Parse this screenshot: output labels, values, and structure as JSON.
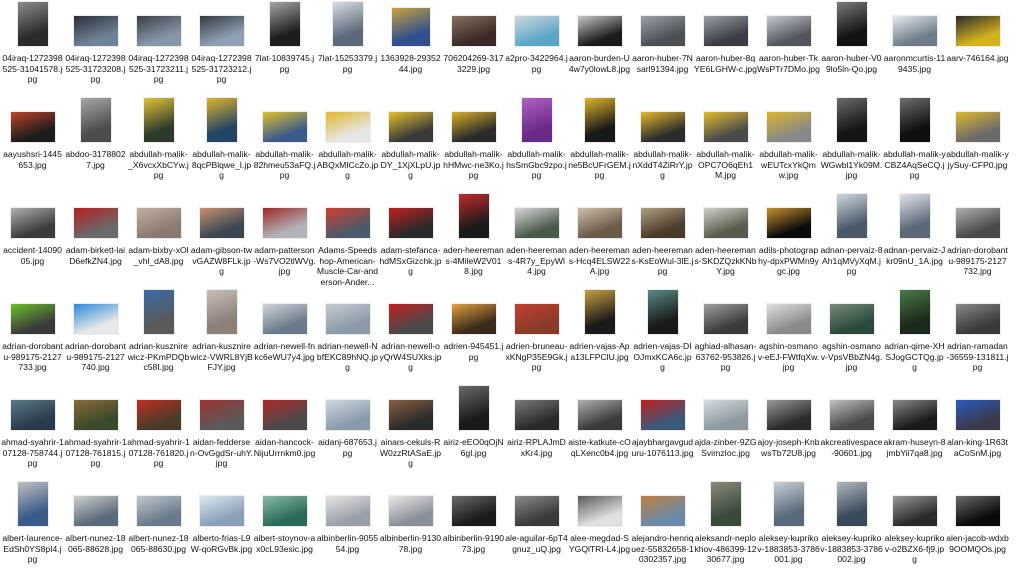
{
  "files": [
    {
      "name": "04iraq-1272398525-31041578.jpg",
      "shape": "portrait",
      "c1": "#2b2b2b",
      "c2": "#8c8c8c"
    },
    {
      "name": "04iraq-1272398525-31723208.jpg",
      "shape": "landscape",
      "c1": "#6f8296",
      "c2": "#2a3038"
    },
    {
      "name": "04iraq-1272398525-31723211.jpg",
      "shape": "landscape",
      "c1": "#8797a8",
      "c2": "#3a3f46"
    },
    {
      "name": "04iraq-1272398525-31723212.jpg",
      "shape": "landscape",
      "c1": "#8fa0b2",
      "c2": "#353a42"
    },
    {
      "name": "7lat-10839745.jpg",
      "shape": "portrait",
      "c1": "#1d1d1d",
      "c2": "#a6a6a6"
    },
    {
      "name": "7lat-15253379.jpg",
      "shape": "portrait",
      "c1": "#5b6a7a",
      "c2": "#d9dde2"
    },
    {
      "name": "1363928-2935244.jpg",
      "shape": "square",
      "c1": "#2f4f8f",
      "c2": "#c9a33a"
    },
    {
      "name": "706204269-3173229.jpg",
      "shape": "landscape",
      "c1": "#3b2a24",
      "c2": "#8a7060"
    },
    {
      "name": "a2pro-3422964.jpg",
      "shape": "landscape",
      "c1": "#5aa6c6",
      "c2": "#d1d8de"
    },
    {
      "name": "aaron-burden-U4w7y0lowL8.jpg",
      "shape": "landscape",
      "c1": "#1b1b1b",
      "c2": "#c8c8c8"
    },
    {
      "name": "aaron-huber-7Nsarl91394.jpg",
      "shape": "landscape",
      "c1": "#4a4f54",
      "c2": "#9aa1a8"
    },
    {
      "name": "aaron-huber-8qYE6LGHW-c.jpg",
      "shape": "landscape",
      "c1": "#3a3e44",
      "c2": "#9a9fa6"
    },
    {
      "name": "aaron-huber-TkWsPTr7DMo.jpg",
      "shape": "landscape",
      "c1": "#50565c",
      "c2": "#c6cbd0"
    },
    {
      "name": "aaron-huber-V09lo5ln-Qo.jpg",
      "shape": "portrait",
      "c1": "#121212",
      "c2": "#7a7a7a"
    },
    {
      "name": "aaronmcurtis-119435.jpg",
      "shape": "landscape",
      "c1": "#6d7c88",
      "c2": "#e8ecef"
    },
    {
      "name": "aarv-746164.jpg",
      "shape": "landscape",
      "c1": "#d4b21e",
      "c2": "#2a2a2a"
    },
    {
      "name": "aayushsri-1445653.jpg",
      "shape": "landscape",
      "c1": "#1c1c1c",
      "c2": "#c0422a"
    },
    {
      "name": "abdoo-31788027.jpg",
      "shape": "portrait",
      "c1": "#4c4c4c",
      "c2": "#a8a8a8"
    },
    {
      "name": "abdullah-malik-_X6vcxXbCYw.jpg",
      "shape": "portrait",
      "c1": "#2c3b2c",
      "c2": "#e2c23a"
    },
    {
      "name": "abdullah-malik-8qcPBlqwe_I.jpg",
      "shape": "portrait",
      "c1": "#224466",
      "c2": "#e0b42a"
    },
    {
      "name": "abdullah-malik-82hmeu53aFQ.jpg",
      "shape": "landscape",
      "c1": "#3a5a8a",
      "c2": "#e0c030"
    },
    {
      "name": "abdullah-malik-ABQxMICcZo.jpg",
      "shape": "landscape",
      "c1": "#e6e6e6",
      "c2": "#e0b82a"
    },
    {
      "name": "abdullah-malik-DY_1XjXLpU.jpg",
      "shape": "landscape",
      "c1": "#3a3a3a",
      "c2": "#e4c02c"
    },
    {
      "name": "abdullah-malik-hHMwc-ne3Ko.jpg",
      "shape": "landscape",
      "c1": "#2a2a2a",
      "c2": "#d8b02a"
    },
    {
      "name": "abdullah-malik-hsSmGbc9zpo.jpg",
      "shape": "portrait",
      "c1": "#6a2a8a",
      "c2": "#b060c0"
    },
    {
      "name": "abdullah-malik-ne5BcUFrGEM.jpg",
      "shape": "portrait",
      "c1": "#181818",
      "c2": "#dfb42a"
    },
    {
      "name": "abdullah-malik-nXddT4ZiRrY.jpg",
      "shape": "landscape",
      "c1": "#2c2c2c",
      "c2": "#e2b82c"
    },
    {
      "name": "abdullah-malik-OPC7O6qEh1M.jpg",
      "shape": "landscape",
      "c1": "#4a4a4a",
      "c2": "#e2bc2c"
    },
    {
      "name": "abdullah-malik-wEUTcxYkQmw.jpg",
      "shape": "landscape",
      "c1": "#888888",
      "c2": "#dcb62a"
    },
    {
      "name": "abdullah-malik-WGwbl1Yk09M.jpg",
      "shape": "portrait",
      "c1": "#141414",
      "c2": "#6a6a6a"
    },
    {
      "name": "abdullah-malik-yCBZ4AqSeCQ.jpg",
      "shape": "portrait",
      "c1": "#0e0e0e",
      "c2": "#6e6e6e"
    },
    {
      "name": "abdullah-malik-yjySuy-CFP0.jpg",
      "shape": "landscape",
      "c1": "#6a6a6a",
      "c2": "#e0b82c"
    },
    {
      "name": "accident-1409005.jpg",
      "shape": "landscape",
      "c1": "#3c3c3c",
      "c2": "#b0b0b0"
    },
    {
      "name": "adam-birkett-laiD6efkZN4.jpg",
      "shape": "landscape",
      "c1": "#6a6a6a",
      "c2": "#b42020"
    },
    {
      "name": "adam-bixby-xOl_vhl_dA8.jpg",
      "shape": "landscape",
      "c1": "#8a7a70",
      "c2": "#c0b0a4"
    },
    {
      "name": "adam-gibson-twvGAZW8FLk.jpg",
      "shape": "landscape",
      "c1": "#3a4652",
      "c2": "#c89070"
    },
    {
      "name": "adam-patterson-Ws7VO2tlWVg.jpg",
      "shape": "landscape",
      "c1": "#b0b4b8",
      "c2": "#a02828"
    },
    {
      "name": "Adams-Speedshop-American-Muscle-Car-anderson-Ander...",
      "shape": "landscape",
      "c1": "#4a5a6a",
      "c2": "#d04030"
    },
    {
      "name": "adam-stefanca-hdMSxGizchk.jpg",
      "shape": "landscape",
      "c1": "#2a2a2a",
      "c2": "#c02020"
    },
    {
      "name": "aden-heeremans-4MileW2V018.jpg",
      "shape": "portrait",
      "c1": "#1a1a1a",
      "c2": "#c02a2a"
    },
    {
      "name": "aden-heeremans-4R7y_EpyWl4.jpg",
      "shape": "landscape",
      "c1": "#4a5a4a",
      "c2": "#d8d8d8"
    },
    {
      "name": "aden-heeremans-Hcq4ELSW22A.jpg",
      "shape": "landscape",
      "c1": "#6a5a4a",
      "c2": "#cfc0a8"
    },
    {
      "name": "aden-heeremans-KsEoWul-3lE.jpg",
      "shape": "landscape",
      "c1": "#4a3a2a",
      "c2": "#b0a080"
    },
    {
      "name": "aden-heeremans-SKDZQzkKNbY.jpg",
      "shape": "landscape",
      "c1": "#5a5a4a",
      "c2": "#d0d0c8"
    },
    {
      "name": "adils-photography-dpxPWMn9ygc.jpg",
      "shape": "landscape",
      "c1": "#0a0a0a",
      "c2": "#c89030"
    },
    {
      "name": "adnan-pervaiz-8Ah1qMVyXqM.jpg",
      "shape": "portrait",
      "c1": "#4a5868",
      "c2": "#d0d8e0"
    },
    {
      "name": "adnan-pervaiz-Jkr09nU_1A.jpg",
      "shape": "portrait",
      "c1": "#5a6878",
      "c2": "#e0e4e8"
    },
    {
      "name": "adrian-dorobantu-989175-2127732.jpg",
      "shape": "landscape",
      "c1": "#4a4a4a",
      "c2": "#b0b0b0"
    },
    {
      "name": "adrian-dorobantu-989175-2127733.jpg",
      "shape": "landscape",
      "c1": "#3a3a3a",
      "c2": "#6ac02a"
    },
    {
      "name": "adrian-dorobantu-989175-2127740.jpg",
      "shape": "landscape",
      "c1": "#e8e8e8",
      "c2": "#2a8ad8"
    },
    {
      "name": "adrian-kusznirewicz-PKmPDQbc58I.jpg",
      "shape": "portrait",
      "c1": "#5a5a5a",
      "c2": "#3a6aa8"
    },
    {
      "name": "adrian-kusznirewicz-VWRL8YjBFJY.jpg",
      "shape": "portrait",
      "c1": "#8a8078",
      "c2": "#c8c0b8"
    },
    {
      "name": "adrian-newell-fnkc6eWU7y4.jpg",
      "shape": "landscape",
      "c1": "#6a7a8a",
      "c2": "#d0d4d8"
    },
    {
      "name": "adrian-newell-NbfEKC89hNQ.jpg",
      "shape": "landscape",
      "c1": "#8a9aa8",
      "c2": "#c8ccd0"
    },
    {
      "name": "adrian-newell-oyQrW4SUXks.jpg",
      "shape": "landscape",
      "c1": "#4a4a4a",
      "c2": "#c02020"
    },
    {
      "name": "adrien-945451.jpg",
      "shape": "landscape",
      "c1": "#3a2a1a",
      "c2": "#e0a040"
    },
    {
      "name": "adrien-bruneau-xKNgP35E9Gk.jpg",
      "shape": "landscape",
      "c1": "#8a3a2a",
      "c2": "#c04030"
    },
    {
      "name": "adrien-vajas-Apa13LFPClU.jpg",
      "shape": "portrait",
      "c1": "#1a1a1a",
      "c2": "#c8a040"
    },
    {
      "name": "adrien-vajas-DIOJmxKCA6c.jpg",
      "shape": "portrait",
      "c1": "#1a1a1a",
      "c2": "#5a8a8a"
    },
    {
      "name": "aghiad-alhasan-63762-953826.jpg",
      "shape": "landscape",
      "c1": "#3a3a3a",
      "c2": "#a0a0a0"
    },
    {
      "name": "agshin-osmanov-eEJ-FWtfqXw.jpg",
      "shape": "landscape",
      "c1": "#8a8a8a",
      "c2": "#e0e0e0"
    },
    {
      "name": "agshin-osmanov-VpsVBbZN4g.jpg",
      "shape": "landscape",
      "c1": "#2a4a3a",
      "c2": "#7a8a7a"
    },
    {
      "name": "adrian-qime-XHSJogGCTQg.jpg",
      "shape": "portrait",
      "c1": "#1a2a1a",
      "c2": "#4a7a4a"
    },
    {
      "name": "adrian-ramadan-36559-131811.jpg",
      "shape": "landscape",
      "c1": "#3a3a3a",
      "c2": "#8a8a8a"
    },
    {
      "name": "ahmad-syahrir-107128-758744.jpg",
      "shape": "landscape",
      "c1": "#2a3a4a",
      "c2": "#5a7a8a"
    },
    {
      "name": "ahmad-syahrir-107128-761815.jpg",
      "shape": "landscape",
      "c1": "#3a4a2a",
      "c2": "#8a6a3a"
    },
    {
      "name": "ahmad-syahrir-107128-761820.jpg",
      "shape": "landscape",
      "c1": "#4a3a2a",
      "c2": "#c03020"
    },
    {
      "name": "aidan-fedderse n-OvGgdSr-uhY.jpg",
      "shape": "landscape",
      "c1": "#5a5a5a",
      "c2": "#a03030"
    },
    {
      "name": "aidan-hancock-NijuUrrnkm0.jpg",
      "shape": "landscape",
      "c1": "#4a4a4a",
      "c2": "#b02828"
    },
    {
      "name": "aidanj-687653.jpg",
      "shape": "landscape",
      "c1": "#8a9aaa",
      "c2": "#d0d8e0"
    },
    {
      "name": "ainars-cekuls-RW0zzRtASaE.jpg",
      "shape": "landscape",
      "c1": "#2a2a2a",
      "c2": "#8a6040"
    },
    {
      "name": "airiz-eEO0qOjN6gI.jpg",
      "shape": "portrait",
      "c1": "#1a1a1a",
      "c2": "#6a6a6a"
    },
    {
      "name": "airiz-RPLAJmDxKr4.jpg",
      "shape": "landscape",
      "c1": "#2a2a2a",
      "c2": "#7a7a7a"
    },
    {
      "name": "aiste-katkute-cOqLXenc0b4.jpg",
      "shape": "landscape",
      "c1": "#3a3a3a",
      "c2": "#b0b0b0"
    },
    {
      "name": "ajaybhargavguduru-1076113.jpg",
      "shape": "landscape",
      "c1": "#3a5a7a",
      "c2": "#c02020"
    },
    {
      "name": "ajda-zinber-9ZGSvimzIoc.jpg",
      "shape": "landscape",
      "c1": "#8a9aa0",
      "c2": "#d8dcde"
    },
    {
      "name": "ajoy-joseph-KnbwsTb72U8.jpg",
      "shape": "landscape",
      "c1": "#2a2a2a",
      "c2": "#9a9a9a"
    },
    {
      "name": "akcreativespace-90601.jpg",
      "shape": "landscape",
      "c1": "#4a4a4a",
      "c2": "#c0c0c0"
    },
    {
      "name": "akram-huseyn-8jmbYii7qa8.jpg",
      "shape": "landscape",
      "c1": "#1a1a1a",
      "c2": "#8a8a8a"
    },
    {
      "name": "alan-king-1R63taCoSnM.jpg",
      "shape": "landscape",
      "c1": "#3a3a4a",
      "c2": "#2a5ac0"
    },
    {
      "name": "albert-laurence-EdSh0YS8pI4.jpg",
      "shape": "portrait",
      "c1": "#3a5a8a",
      "c2": "#c0c0c0"
    },
    {
      "name": "albert-nunez-18065-88628.jpg",
      "shape": "landscape",
      "c1": "#5a6a7a",
      "c2": "#d0d0d0"
    },
    {
      "name": "albert-nunez-18065-88630.jpg",
      "shape": "landscape",
      "c1": "#6a7a8a",
      "c2": "#c0c8d0"
    },
    {
      "name": "alberto-frias-L9W-qoRGvBk.jpg",
      "shape": "landscape",
      "c1": "#8aa0b8",
      "c2": "#e0e8f0"
    },
    {
      "name": "albert-stoynov-ax0cL93esic.jpg",
      "shape": "landscape",
      "c1": "#2a6a5a",
      "c2": "#8ab8a8"
    },
    {
      "name": "albinberlin-905554.jpg",
      "shape": "landscape",
      "c1": "#9aa0a8",
      "c2": "#e4e4e4"
    },
    {
      "name": "albinberlin-913078.jpg",
      "shape": "landscape",
      "c1": "#8a9098",
      "c2": "#e8e8e8"
    },
    {
      "name": "albinberlin-919073.jpg",
      "shape": "landscape",
      "c1": "#1a1a1a",
      "c2": "#6a6a6a"
    },
    {
      "name": "ale-aguilar-6pT4gnuz_uQ.jpg",
      "shape": "landscape",
      "c1": "#3a3a3a",
      "c2": "#8a8a8a"
    },
    {
      "name": "alee-megdad-SYGQlTRI-L4.jpg",
      "shape": "landscape",
      "c1": "#e0e0e0",
      "c2": "#5a5a5a"
    },
    {
      "name": "alejandro-henriquez-55832658-10302357.jpg",
      "shape": "landscape",
      "c1": "#6a8aa8",
      "c2": "#c08040"
    },
    {
      "name": "aleksandr-neplokhov-486399-1230677.jpg",
      "shape": "portrait",
      "c1": "#3a4a3a",
      "c2": "#8a8a7a"
    },
    {
      "name": "aleksey-kuprikov-1883853-3786001.jpg",
      "shape": "portrait",
      "c1": "#5a6a7a",
      "c2": "#c8d0d8"
    },
    {
      "name": "aleksey-kuprikov-1883853-3786002.jpg",
      "shape": "portrait",
      "c1": "#3a4a5a",
      "c2": "#b0b8c0"
    },
    {
      "name": "aleksey-kuprikov-o2BZX6-fj9.jpg",
      "shape": "landscape",
      "c1": "#2a2a2a",
      "c2": "#9a9a9a"
    },
    {
      "name": "alen-jacob-wdxb9OOMQOs.jpg",
      "shape": "landscape",
      "c1": "#0a0a0a",
      "c2": "#6a6a6a"
    }
  ]
}
